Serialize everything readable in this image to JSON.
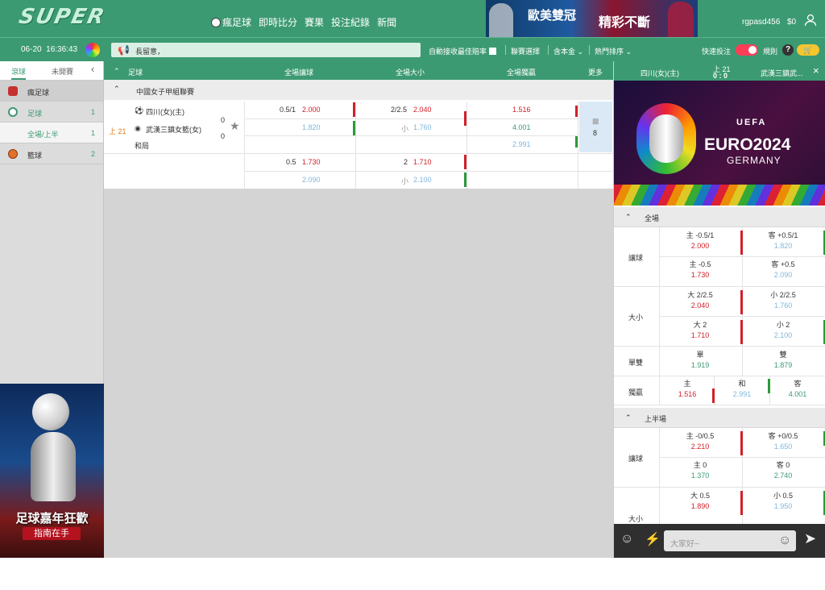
{
  "header": {
    "logo": "SUPER",
    "nav": [
      "瘋足球",
      "即時比分",
      "賽果",
      "投注紀錄",
      "新聞"
    ],
    "banner_text1": "歐美雙冠",
    "banner_text2": "精彩不斷",
    "username": "rgpasd456",
    "balance": "$0"
  },
  "toolbar": {
    "date": "06-20",
    "time": "16:36:43",
    "marquee": "長留意，",
    "auto_accept": "自動接收最佳賠率",
    "league_select": "聯賽選擇",
    "principal": "含本金",
    "sort": "熱門排序",
    "quick_bet": "快速投注",
    "rules": "規則",
    "help": "?"
  },
  "sidebar": {
    "tab_active": "滾球",
    "tab_other": "未開賽",
    "items": [
      {
        "label": "瘋足球",
        "count": ""
      },
      {
        "label": "足球",
        "count": "1"
      },
      {
        "label": "全場/上半",
        "count": "1"
      },
      {
        "label": "籃球",
        "count": "2"
      }
    ],
    "promo_title": "足球嘉年狂歡",
    "promo_sub": "指南在手"
  },
  "table": {
    "headers": {
      "sport": "足球",
      "handicap": "全場讓球",
      "overunder": "全場大小",
      "moneyline": "全場獨贏",
      "more": "更多"
    },
    "league": "中國女子甲組聯賽",
    "match": {
      "time": "上 21",
      "home": "四川(女)(主)",
      "away": "武漢三鎮女籃(女)",
      "draw": "和局",
      "home_score": "0",
      "away_score": "0",
      "more_count": "8"
    },
    "rows": [
      {
        "hdp_line": "0.5/1",
        "hdp_home": "2.000",
        "hdp_away": "1.820",
        "ou_line": "2/2.5",
        "ou_over": "2.040",
        "ou_under_label": "小",
        "ou_under": "1.760",
        "ml_home": "1.516",
        "ml_away": "4.001",
        "ml_draw": "2.991"
      },
      {
        "hdp_line": "0.5",
        "hdp_home": "1.730",
        "hdp_away": "2.090",
        "ou_line": "2",
        "ou_over": "1.710",
        "ou_under_label": "小",
        "ou_under": "2.100"
      }
    ]
  },
  "right_panel": {
    "home": "四川(女)(主)",
    "away": "武漢三鎮武...",
    "period": "上 21",
    "score": "0 : 0",
    "banner_uefa": "UEFA",
    "banner_euro": "EURO2024",
    "banner_country": "GERMANY",
    "full_time": "全場",
    "half_time": "上半場",
    "ft": {
      "handicap_label": "讓球",
      "handicap": [
        {
          "h_label": "主 -0.5/1",
          "h_odds": "2.000",
          "a_label": "客 +0.5/1",
          "a_odds": "1.820"
        },
        {
          "h_label": "主 -0.5",
          "h_odds": "1.730",
          "a_label": "客 +0.5",
          "a_odds": "2.090"
        }
      ],
      "ou_label": "大小",
      "ou": [
        {
          "o_label": "大 2/2.5",
          "o_odds": "2.040",
          "u_label": "小 2/2.5",
          "u_odds": "1.760"
        },
        {
          "o_label": "大 2",
          "o_odds": "1.710",
          "u_label": "小 2",
          "u_odds": "2.100"
        }
      ],
      "oe_label": "單雙",
      "odd_label": "單",
      "odd_odds": "1.919",
      "even_label": "雙",
      "even_odds": "1.879",
      "ml_label": "獨贏",
      "ml_home_label": "主",
      "ml_home": "1.516",
      "ml_draw_label": "和",
      "ml_draw": "2.991",
      "ml_away_label": "客",
      "ml_away": "4.001"
    },
    "ht": {
      "handicap_label": "讓球",
      "handicap": [
        {
          "h_label": "主 -0/0.5",
          "h_odds": "2.210",
          "a_label": "客 +0/0.5",
          "a_odds": "1.650"
        },
        {
          "h_label": "主 0",
          "h_odds": "1.370",
          "a_label": "客 0",
          "a_odds": "2.740"
        }
      ],
      "ou_label": "大小",
      "ou": [
        {
          "o_label": "大 0.5",
          "o_odds": "1.890",
          "u_label": "小 0.5",
          "u_odds": "1.950"
        }
      ]
    },
    "chat_placeholder": "大家好~"
  }
}
